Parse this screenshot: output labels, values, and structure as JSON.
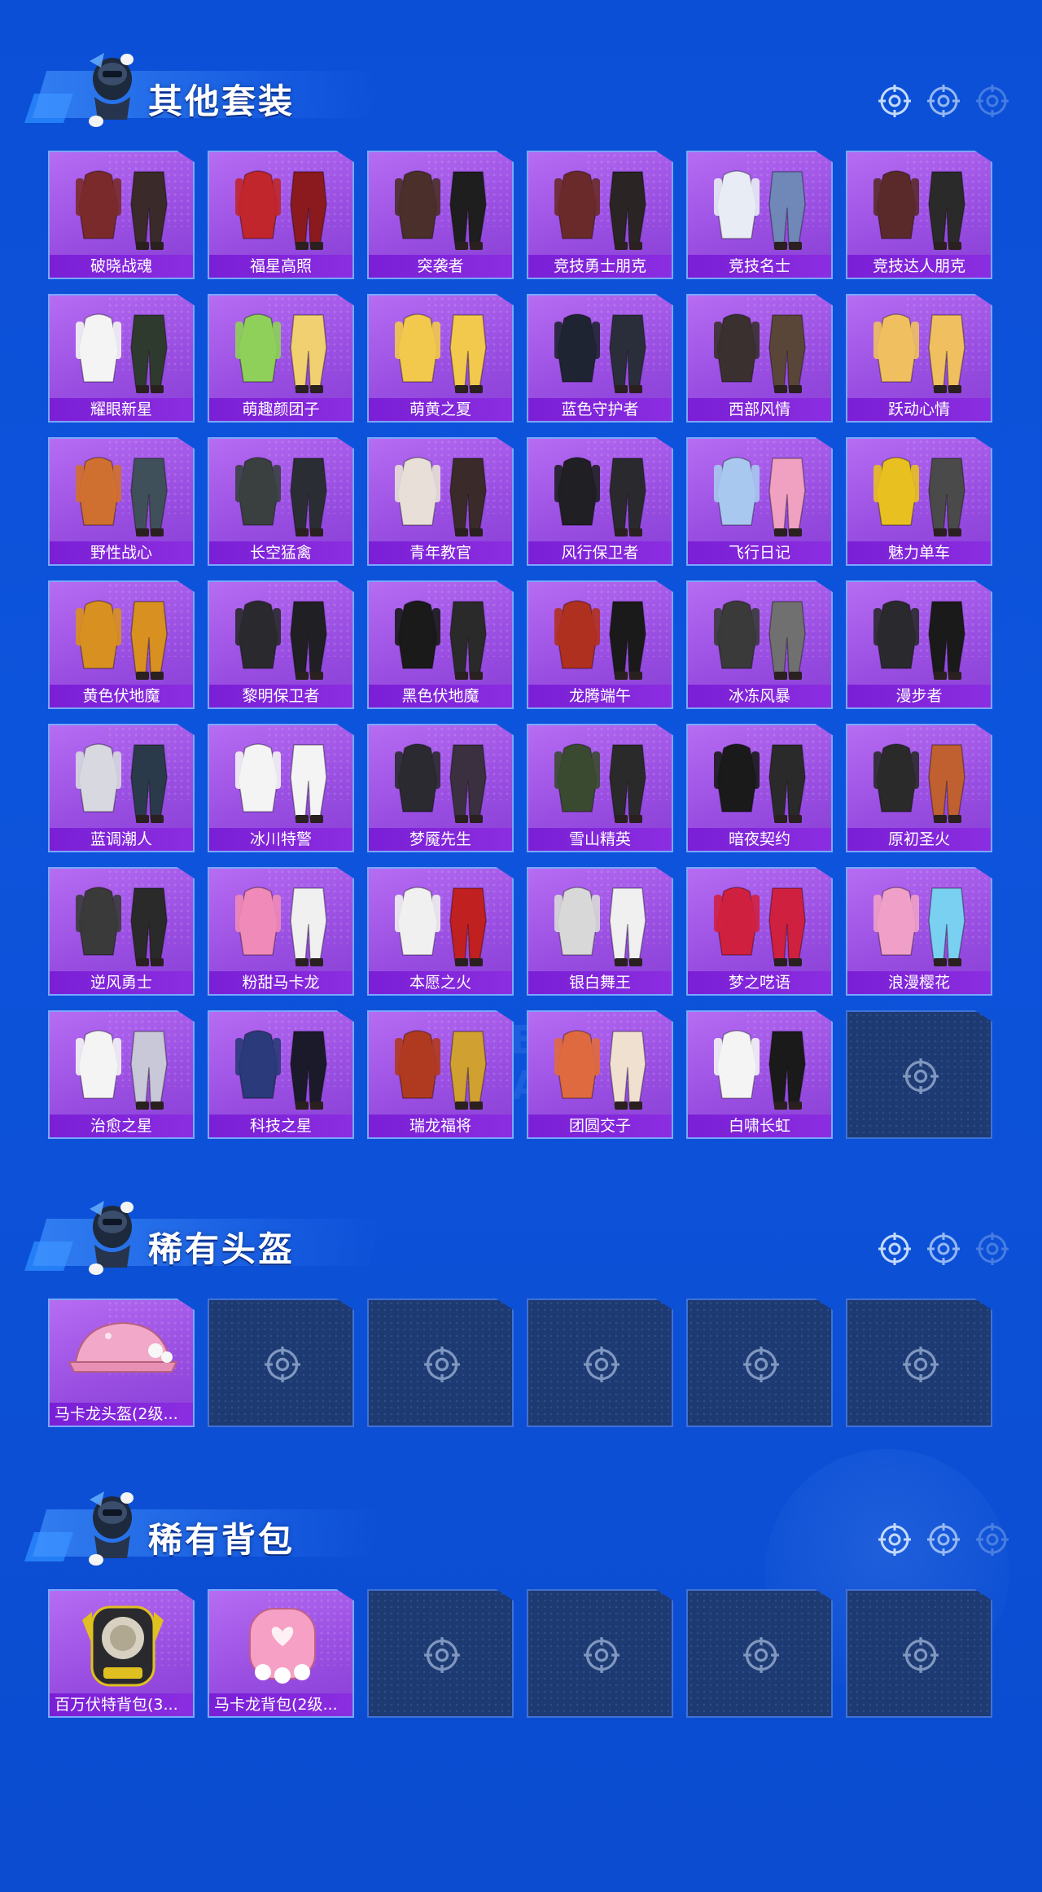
{
  "colors": {
    "background": "#0b4fd6",
    "card_fill": "#9a4fe2",
    "label_fill": "#7a1fd6",
    "empty_card": "#1e3a72",
    "title_text": "#ffffff"
  },
  "watermark": "GAME FOR PEACE",
  "sections": [
    {
      "title": "其他套装",
      "icons": [
        "crosshair-icon",
        "crosshair-icon",
        "crosshair-icon"
      ],
      "items": [
        {
          "label": "破晓战魂",
          "icon": "outfit-icon"
        },
        {
          "label": "福星高照",
          "icon": "outfit-icon"
        },
        {
          "label": "突袭者",
          "icon": "outfit-icon"
        },
        {
          "label": "竞技勇士朋克",
          "icon": "outfit-icon"
        },
        {
          "label": "竞技名士",
          "icon": "outfit-icon"
        },
        {
          "label": "竞技达人朋克",
          "icon": "outfit-icon"
        },
        {
          "label": "耀眼新星",
          "icon": "outfit-icon"
        },
        {
          "label": "萌趣颜团子",
          "icon": "outfit-icon"
        },
        {
          "label": "萌黄之夏",
          "icon": "outfit-icon"
        },
        {
          "label": "蓝色守护者",
          "icon": "outfit-icon"
        },
        {
          "label": "西部风情",
          "icon": "outfit-icon"
        },
        {
          "label": "跃动心情",
          "icon": "outfit-icon"
        },
        {
          "label": "野性战心",
          "icon": "outfit-icon"
        },
        {
          "label": "长空猛禽",
          "icon": "outfit-icon"
        },
        {
          "label": "青年教官",
          "icon": "outfit-icon"
        },
        {
          "label": "风行保卫者",
          "icon": "outfit-icon"
        },
        {
          "label": "飞行日记",
          "icon": "outfit-icon"
        },
        {
          "label": "魅力单车",
          "icon": "outfit-icon"
        },
        {
          "label": "黄色伏地魔",
          "icon": "outfit-icon"
        },
        {
          "label": "黎明保卫者",
          "icon": "outfit-icon"
        },
        {
          "label": "黑色伏地魔",
          "icon": "outfit-icon"
        },
        {
          "label": "龙腾端午",
          "icon": "outfit-icon"
        },
        {
          "label": "冰冻风暴",
          "icon": "outfit-icon"
        },
        {
          "label": "漫步者",
          "icon": "outfit-icon"
        },
        {
          "label": "蓝调潮人",
          "icon": "outfit-icon"
        },
        {
          "label": "冰川特警",
          "icon": "outfit-icon"
        },
        {
          "label": "梦魇先生",
          "icon": "outfit-icon"
        },
        {
          "label": "雪山精英",
          "icon": "outfit-icon"
        },
        {
          "label": "暗夜契约",
          "icon": "outfit-icon"
        },
        {
          "label": "原初圣火",
          "icon": "outfit-icon"
        },
        {
          "label": "逆风勇士",
          "icon": "outfit-icon"
        },
        {
          "label": "粉甜马卡龙",
          "icon": "outfit-icon"
        },
        {
          "label": "本愿之火",
          "icon": "outfit-icon"
        },
        {
          "label": "银白舞王",
          "icon": "outfit-icon"
        },
        {
          "label": "梦之呓语",
          "icon": "outfit-icon"
        },
        {
          "label": "浪漫樱花",
          "icon": "outfit-icon"
        },
        {
          "label": "治愈之星",
          "icon": "outfit-icon"
        },
        {
          "label": "科技之星",
          "icon": "outfit-icon"
        },
        {
          "label": "瑞龙福将",
          "icon": "outfit-icon"
        },
        {
          "label": "团圆交子",
          "icon": "outfit-icon"
        },
        {
          "label": "白啸长虹",
          "icon": "outfit-icon"
        },
        {
          "label": null,
          "icon": "empty-slot-icon"
        }
      ]
    },
    {
      "title": "稀有头盔",
      "icons": [
        "crosshair-icon",
        "crosshair-icon",
        "crosshair-icon"
      ],
      "items": [
        {
          "label": "马卡龙头盔(2级...",
          "icon": "helmet-icon"
        },
        {
          "label": null,
          "icon": "empty-slot-icon"
        },
        {
          "label": null,
          "icon": "empty-slot-icon"
        },
        {
          "label": null,
          "icon": "empty-slot-icon"
        },
        {
          "label": null,
          "icon": "empty-slot-icon"
        },
        {
          "label": null,
          "icon": "empty-slot-icon"
        }
      ]
    },
    {
      "title": "稀有背包",
      "icons": [
        "crosshair-icon",
        "crosshair-icon",
        "crosshair-icon"
      ],
      "items": [
        {
          "label": "百万伏特背包(3...",
          "icon": "backpack-icon"
        },
        {
          "label": "马卡龙背包(2级...",
          "icon": "backpack-icon"
        },
        {
          "label": null,
          "icon": "empty-slot-icon"
        },
        {
          "label": null,
          "icon": "empty-slot-icon"
        },
        {
          "label": null,
          "icon": "empty-slot-icon"
        },
        {
          "label": null,
          "icon": "empty-slot-icon"
        }
      ]
    }
  ]
}
